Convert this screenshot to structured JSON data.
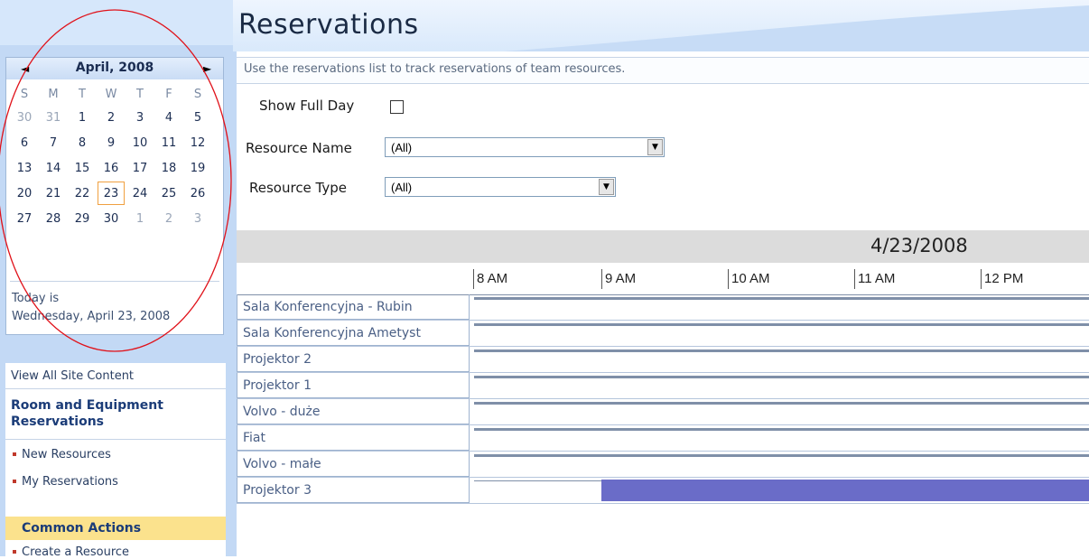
{
  "page": {
    "title": "Reservations"
  },
  "calendar": {
    "month": "April, 2008",
    "weekdays": [
      "S",
      "M",
      "T",
      "W",
      "T",
      "F",
      "S"
    ],
    "weeks": [
      [
        "30",
        "31",
        "1",
        "2",
        "3",
        "4",
        "5"
      ],
      [
        "6",
        "7",
        "8",
        "9",
        "10",
        "11",
        "12"
      ],
      [
        "13",
        "14",
        "15",
        "16",
        "17",
        "18",
        "19"
      ],
      [
        "20",
        "21",
        "22",
        "23",
        "24",
        "25",
        "26"
      ],
      [
        "27",
        "28",
        "29",
        "30",
        "1",
        "2",
        "3"
      ]
    ],
    "today_line1": "Today is",
    "today_line2": "Wednesday, April 23, 2008"
  },
  "nav": {
    "view_all": "View All Site Content",
    "section1": "Room and Equipment Reservations",
    "new_resources": "New Resources",
    "my_reservations": "My Reservations",
    "section2": "Common Actions",
    "create_resource": "Create a Resource"
  },
  "main": {
    "description": "Use the reservations list to track reservations of team resources.",
    "show_full_day": "Show Full Day",
    "resource_name_label": "Resource Name",
    "resource_name_value": "(All)",
    "resource_type_label": "Resource Type",
    "resource_type_value": "(All)",
    "date": "4/23/2008",
    "times": [
      "8 AM",
      "9 AM",
      "10 AM",
      "11 AM",
      "12 PM"
    ],
    "resources": [
      "Sala Konferencyjna - Rubin",
      "Sala Konferencyjna Ametyst",
      "Projektor 2",
      "Projektor 1",
      "Volvo - duże",
      "Fiat",
      "Volvo - małe",
      "Projektor 3"
    ]
  },
  "colors": {
    "booking": "#6a6cc8",
    "today_border": "#f0a040",
    "annotation_circle": "#e0121a"
  }
}
